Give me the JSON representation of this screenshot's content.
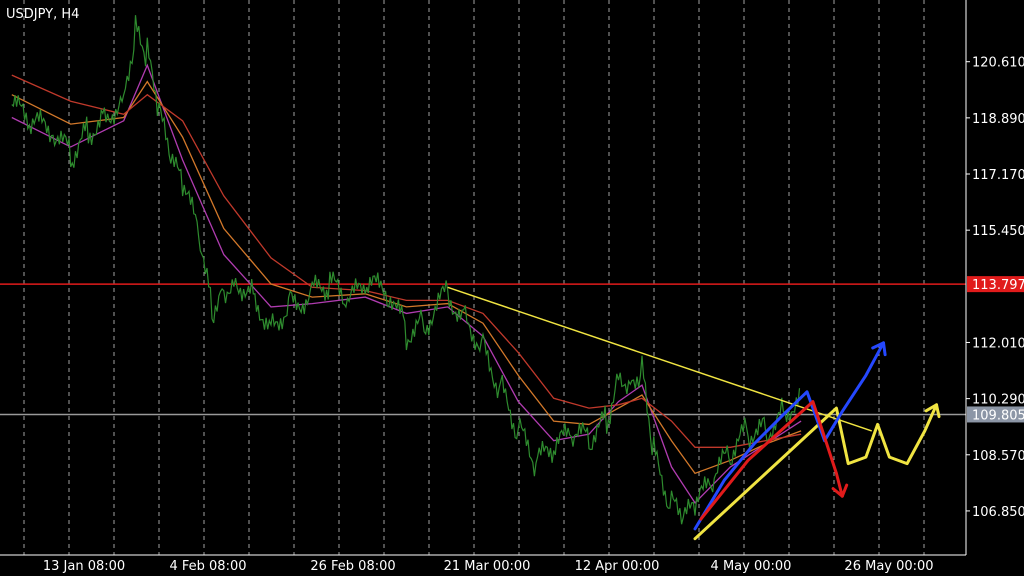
{
  "chart_data": {
    "type": "line",
    "title": "USDJPY, H4",
    "symbol": "USDJPY",
    "timeframe": "H4",
    "background": "#000000",
    "grid": {
      "vertical_dashed": true,
      "color": "#d9d9d9"
    },
    "x_labels": [
      "13 Jan 08:00",
      "4 Feb 08:00",
      "26 Feb 08:00",
      "21 Mar 00:00",
      "12 Apr 00:00",
      "4 May 00:00",
      "26 May 00:00"
    ],
    "y_ticks": [
      "120.610",
      "118.890",
      "117.170",
      "115.450",
      "112.010",
      "110.290",
      "108.570",
      "106.850"
    ],
    "ylim": [
      105.5,
      122.5
    ],
    "price_series": {
      "color": "#2e8b2e",
      "points": [
        [
          "2022-01-06",
          119.3
        ],
        [
          "2022-01-09",
          118.7
        ],
        [
          "2022-01-13",
          118.5
        ],
        [
          "2022-01-16",
          117.7
        ],
        [
          "2022-01-19",
          118.5
        ],
        [
          "2022-01-22",
          119.0
        ],
        [
          "2022-01-25",
          119.5
        ],
        [
          "2022-01-27",
          121.6
        ],
        [
          "2022-01-29",
          120.8
        ],
        [
          "2022-01-31",
          119.0
        ],
        [
          "2022-02-02",
          117.5
        ],
        [
          "2022-02-04",
          116.8
        ],
        [
          "2022-02-07",
          115.2
        ],
        [
          "2022-02-09",
          113.0
        ],
        [
          "2022-02-11",
          113.7
        ],
        [
          "2022-02-13",
          114.0
        ],
        [
          "2022-02-16",
          113.5
        ],
        [
          "2022-02-19",
          112.5
        ],
        [
          "2022-02-22",
          113.2
        ],
        [
          "2022-02-26",
          113.5
        ],
        [
          "2022-03-01",
          113.8
        ],
        [
          "2022-03-04",
          113.2
        ],
        [
          "2022-03-07",
          113.7
        ],
        [
          "2022-03-11",
          113.6
        ],
        [
          "2022-03-14",
          112.3
        ],
        [
          "2022-03-17",
          112.6
        ],
        [
          "2022-03-21",
          113.5
        ],
        [
          "2022-03-24",
          112.8
        ],
        [
          "2022-03-27",
          111.9
        ],
        [
          "2022-03-30",
          110.6
        ],
        [
          "2022-04-02",
          109.3
        ],
        [
          "2022-04-05",
          108.3
        ],
        [
          "2022-04-08",
          108.7
        ],
        [
          "2022-04-11",
          109.2
        ],
        [
          "2022-04-14",
          109.0
        ],
        [
          "2022-04-17",
          109.6
        ],
        [
          "2022-04-19",
          111.2
        ],
        [
          "2022-04-21",
          110.8
        ],
        [
          "2022-04-23",
          111.3
        ],
        [
          "2022-04-25",
          108.6
        ],
        [
          "2022-04-28",
          107.0
        ],
        [
          "2022-04-30",
          106.5
        ],
        [
          "2022-05-02",
          106.9
        ],
        [
          "2022-05-05",
          107.8
        ],
        [
          "2022-05-08",
          108.6
        ],
        [
          "2022-05-11",
          109.3
        ],
        [
          "2022-05-14",
          109.3
        ],
        [
          "2022-05-17",
          109.9
        ],
        [
          "2022-05-20",
          110.4
        ]
      ]
    },
    "moving_averages": [
      {
        "color": "#b03cb0",
        "points": [
          [
            "2022-01-06",
            118.9
          ],
          [
            "2022-01-16",
            118.0
          ],
          [
            "2022-01-25",
            118.8
          ],
          [
            "2022-01-29",
            120.5
          ],
          [
            "2022-02-04",
            117.6
          ],
          [
            "2022-02-11",
            114.7
          ],
          [
            "2022-02-19",
            113.1
          ],
          [
            "2022-02-26",
            113.2
          ],
          [
            "2022-03-07",
            113.4
          ],
          [
            "2022-03-14",
            112.9
          ],
          [
            "2022-03-21",
            113.1
          ],
          [
            "2022-03-27",
            112.2
          ],
          [
            "2022-04-02",
            110.2
          ],
          [
            "2022-04-08",
            109.0
          ],
          [
            "2022-04-14",
            109.2
          ],
          [
            "2022-04-19",
            110.2
          ],
          [
            "2022-04-23",
            110.7
          ],
          [
            "2022-04-28",
            108.2
          ],
          [
            "2022-05-02",
            107.1
          ],
          [
            "2022-05-08",
            108.2
          ],
          [
            "2022-05-14",
            108.9
          ],
          [
            "2022-05-20",
            109.6
          ]
        ]
      },
      {
        "color": "#d2782a",
        "points": [
          [
            "2022-01-06",
            119.6
          ],
          [
            "2022-01-16",
            118.7
          ],
          [
            "2022-01-25",
            118.9
          ],
          [
            "2022-01-29",
            120.0
          ],
          [
            "2022-02-04",
            118.3
          ],
          [
            "2022-02-11",
            115.5
          ],
          [
            "2022-02-19",
            113.8
          ],
          [
            "2022-02-26",
            113.4
          ],
          [
            "2022-03-07",
            113.5
          ],
          [
            "2022-03-14",
            113.1
          ],
          [
            "2022-03-21",
            113.2
          ],
          [
            "2022-03-27",
            112.6
          ],
          [
            "2022-04-02",
            111.0
          ],
          [
            "2022-04-08",
            109.6
          ],
          [
            "2022-04-14",
            109.5
          ],
          [
            "2022-04-19",
            110.0
          ],
          [
            "2022-04-23",
            110.4
          ],
          [
            "2022-04-28",
            109.0
          ],
          [
            "2022-05-02",
            108.0
          ],
          [
            "2022-05-08",
            108.4
          ],
          [
            "2022-05-14",
            108.9
          ],
          [
            "2022-05-20",
            109.3
          ]
        ]
      },
      {
        "color": "#c0392b",
        "points": [
          [
            "2022-01-06",
            120.2
          ],
          [
            "2022-01-16",
            119.4
          ],
          [
            "2022-01-25",
            119.0
          ],
          [
            "2022-01-29",
            119.6
          ],
          [
            "2022-02-04",
            118.8
          ],
          [
            "2022-02-11",
            116.5
          ],
          [
            "2022-02-19",
            114.6
          ],
          [
            "2022-02-26",
            113.7
          ],
          [
            "2022-03-07",
            113.6
          ],
          [
            "2022-03-14",
            113.3
          ],
          [
            "2022-03-21",
            113.3
          ],
          [
            "2022-03-27",
            112.9
          ],
          [
            "2022-04-02",
            111.7
          ],
          [
            "2022-04-08",
            110.3
          ],
          [
            "2022-04-14",
            110.0
          ],
          [
            "2022-04-19",
            110.1
          ],
          [
            "2022-04-23",
            110.3
          ],
          [
            "2022-04-28",
            109.6
          ],
          [
            "2022-05-02",
            108.8
          ],
          [
            "2022-05-08",
            108.8
          ],
          [
            "2022-05-14",
            109.0
          ],
          [
            "2022-05-20",
            109.2
          ]
        ]
      }
    ],
    "horizontal_lines": [
      {
        "value": 113.797,
        "label": "113.797",
        "color": "#e11b1b",
        "label_bg": "#e11b1b"
      },
      {
        "value": 109.805,
        "label": "109.805",
        "color": "#9a9a9a",
        "label_bg": "#8c96a6"
      }
    ],
    "trendline": {
      "color": "#f0e442",
      "points": [
        [
          "2022-03-21",
          113.7
        ],
        [
          "2022-06-01",
          109.3
        ]
      ]
    },
    "drawings": [
      {
        "color": "#f0e442",
        "points": [
          [
            "2022-05-02",
            106.0
          ],
          [
            "2022-05-26",
            110.0
          ],
          [
            "2022-05-28",
            108.3
          ],
          [
            "2022-05-31",
            108.5
          ],
          [
            "2022-06-02",
            109.5
          ],
          [
            "2022-06-04",
            108.5
          ],
          [
            "2022-06-07",
            108.3
          ],
          [
            "2022-06-10",
            109.3
          ],
          [
            "2022-06-12",
            110.1
          ]
        ]
      },
      {
        "color": "#2548ff",
        "points": [
          [
            "2022-05-02",
            106.3
          ],
          [
            "2022-05-07",
            107.8
          ],
          [
            "2022-05-12",
            108.9
          ],
          [
            "2022-05-17",
            109.8
          ],
          [
            "2022-05-21",
            110.5
          ],
          [
            "2022-05-24",
            109.0
          ],
          [
            "2022-05-27",
            109.9
          ],
          [
            "2022-05-31",
            111.0
          ],
          [
            "2022-06-03",
            112.0
          ]
        ]
      },
      {
        "color": "#e11b1b",
        "points": [
          [
            "2022-05-03",
            106.6
          ],
          [
            "2022-05-11",
            108.4
          ],
          [
            "2022-05-22",
            110.2
          ],
          [
            "2022-05-26",
            108.0
          ],
          [
            "2022-05-27",
            107.3
          ]
        ]
      }
    ]
  }
}
